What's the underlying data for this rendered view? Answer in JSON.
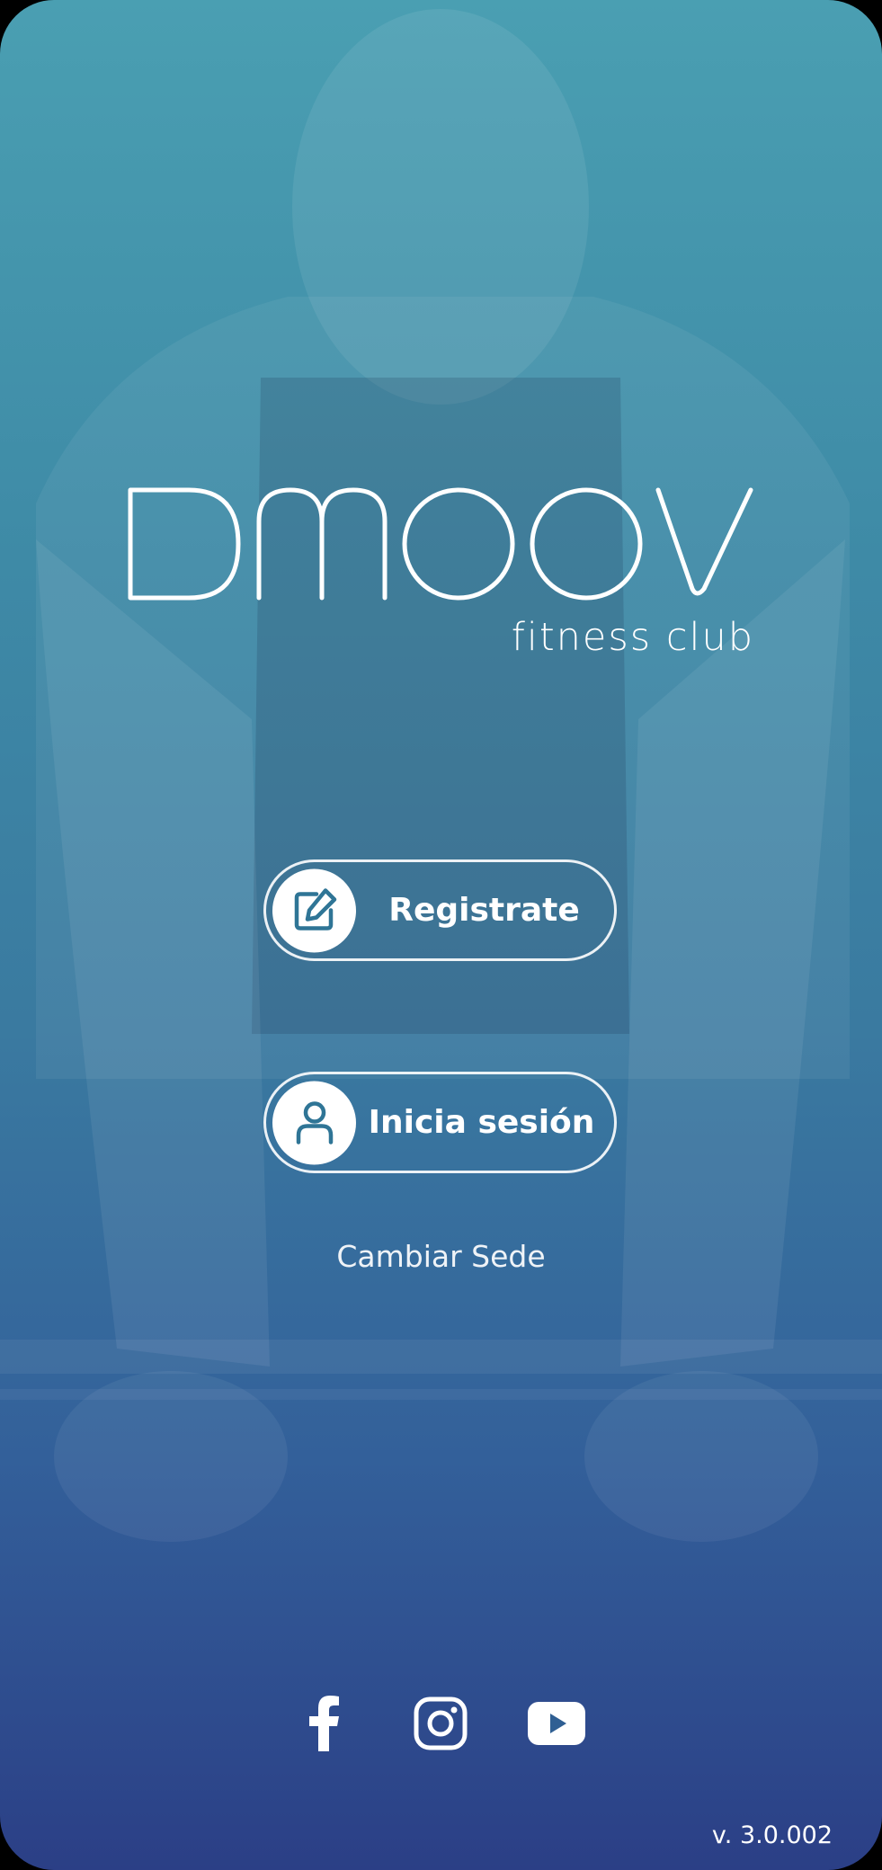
{
  "brand": {
    "logo_text": "DMOOV",
    "tagline": "fitness club"
  },
  "actions": {
    "register_label": "Registrate",
    "register_icon": "edit-icon",
    "login_label": "Inicia sesión",
    "login_icon": "user-icon",
    "change_site_label": "Cambiar Sede"
  },
  "social": [
    {
      "name": "facebook-icon"
    },
    {
      "name": "instagram-icon"
    },
    {
      "name": "youtube-icon"
    }
  ],
  "footer": {
    "version": "v. 3.0.002"
  },
  "colors": {
    "accent": "#2f7596",
    "gradient_top": "#4a9fb2",
    "gradient_bottom": "#2b3f86"
  }
}
